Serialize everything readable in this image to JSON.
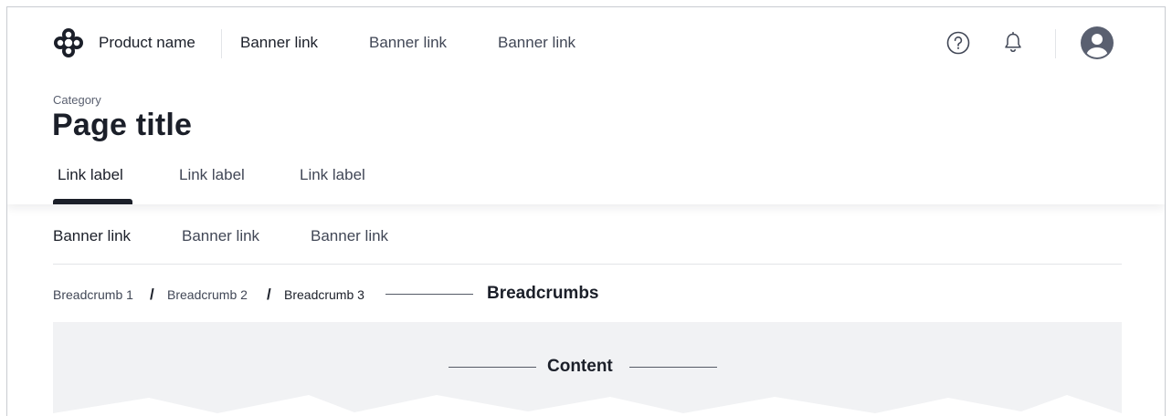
{
  "header": {
    "product_name": "Product name",
    "banner_links": [
      "Banner link",
      "Banner link",
      "Banner link"
    ],
    "icons": {
      "help": "help-icon",
      "notifications": "bell-icon",
      "user": "avatar-icon"
    }
  },
  "page": {
    "category": "Category",
    "title": "Page title",
    "tabs": [
      "Link label",
      "Link label",
      "Link label"
    ],
    "active_tab": 0
  },
  "subnav": {
    "links": [
      "Banner link",
      "Banner link",
      "Banner link"
    ],
    "active": 0
  },
  "breadcrumbs": {
    "items": [
      "Breadcrumb 1",
      "Breadcrumb 2",
      "Breadcrumb 3"
    ],
    "separator": "/",
    "annotation": "Breadcrumbs"
  },
  "content": {
    "annotation": "Content"
  },
  "colors": {
    "text_primary": "#1b1f29",
    "text_secondary": "#414756",
    "content_bg": "#f1f2f4",
    "divider": "#e3e5e8"
  }
}
